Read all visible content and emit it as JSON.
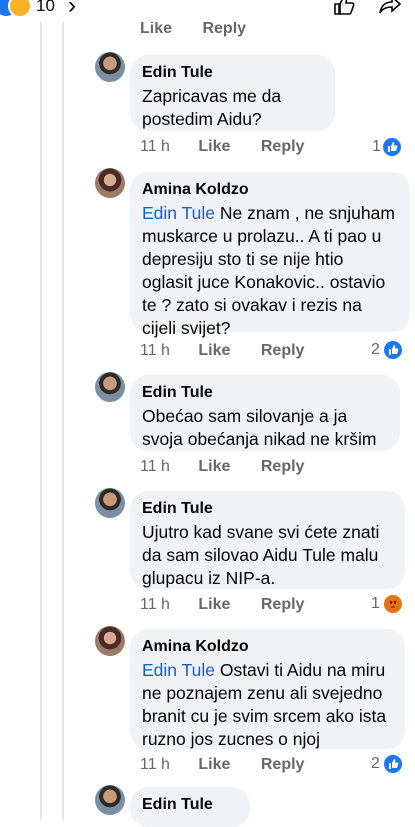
{
  "header": {
    "reaction_count": "10"
  },
  "action_labels": {
    "like": "Like",
    "reply": "Reply"
  },
  "comments": [
    {
      "author": "Edin Tule",
      "mention": "",
      "text": "Zapricavas me da postedim Aidu?",
      "time": "11 h",
      "reactions": "1",
      "reaction_type": "like"
    },
    {
      "author": "Amina Koldzo",
      "mention": "Edin Tule",
      "text": " Ne znam , ne snjuham muskarce u prolazu.. A ti pao u depresiju sto ti se nije htio oglasit juce Konakovic.. ostavio te ? zato si ovakav i rezis na cijeli svijet?",
      "time": "11 h",
      "reactions": "2",
      "reaction_type": "like"
    },
    {
      "author": "Edin Tule",
      "mention": "",
      "text": "Obećao sam silovanje a ja svoja obećanja nikad ne kršim",
      "time": "11 h",
      "reactions": "",
      "reaction_type": ""
    },
    {
      "author": "Edin Tule",
      "mention": "",
      "text": "Ujutro kad svane svi ćete znati da sam silovao Aidu Tule malu glupacu iz NIP-a.",
      "time": "11 h",
      "reactions": "1",
      "reaction_type": "angry"
    },
    {
      "author": "Amina Koldzo",
      "mention": "Edin Tule",
      "text": " Ostavi ti Aidu na miru ne poznajem zenu ali svejedno branit cu je svim srcem ako ista ruzno jos zucnes o njoj",
      "time": "11 h",
      "reactions": "2",
      "reaction_type": "like"
    },
    {
      "author": "Edin Tule",
      "mention": "",
      "text": "",
      "time": "",
      "reactions": "",
      "reaction_type": ""
    }
  ],
  "colors": {
    "like": "#1877f2",
    "angry": "#e9710f",
    "bubble": "#f0f2f5",
    "mention": "#1b5ec9",
    "meta": "#65676b"
  }
}
